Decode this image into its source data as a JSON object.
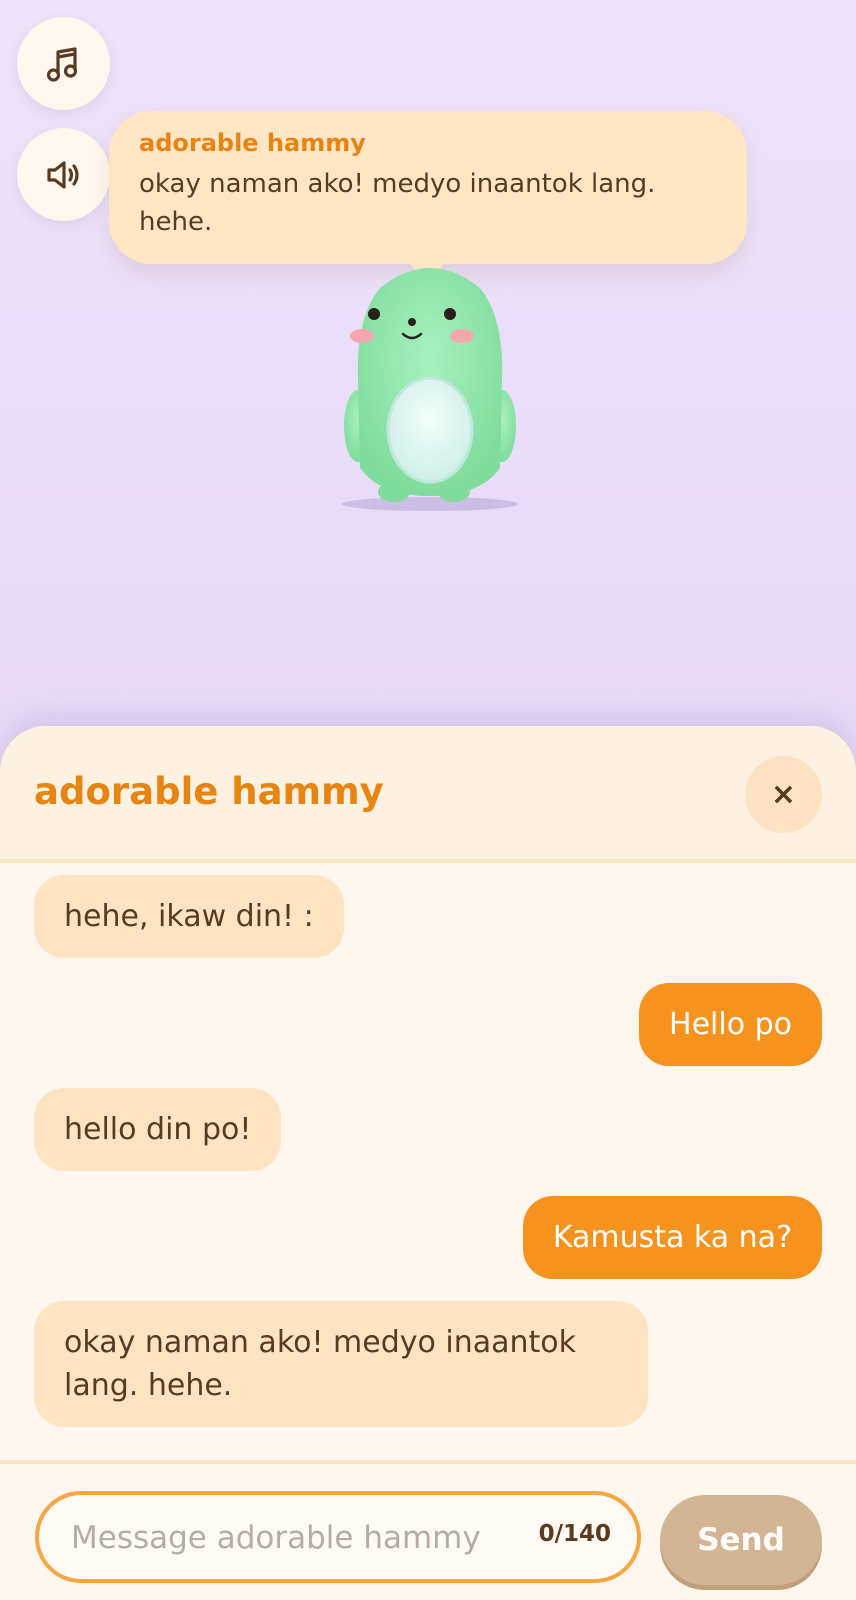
{
  "top_controls": {
    "music_icon": "music-note-icon",
    "sound_icon": "speaker-icon"
  },
  "speech_bubble": {
    "name": "adorable hammy",
    "text": "okay naman ako! medyo inaantok lang. hehe."
  },
  "chat_panel": {
    "title": "adorable hammy",
    "close_label": "×",
    "messages": [
      {
        "from": "bot",
        "text": "hehe, ikaw din! :"
      },
      {
        "from": "user",
        "text": "Hello po"
      },
      {
        "from": "bot",
        "text": "hello din po!"
      },
      {
        "from": "user",
        "text": "Kamusta ka na?"
      },
      {
        "from": "bot",
        "text": "okay naman ako! medyo inaantok lang. hehe."
      }
    ]
  },
  "composer": {
    "placeholder": "Message adorable hammy",
    "value": "",
    "counter": "0/140",
    "send_label": "Send"
  },
  "colors": {
    "accent": "#e88412",
    "user_bubble": "#f6931f",
    "bot_bubble": "#ffe4c3",
    "send_disabled": "#d4b593",
    "mascot": "#86e4a4"
  }
}
